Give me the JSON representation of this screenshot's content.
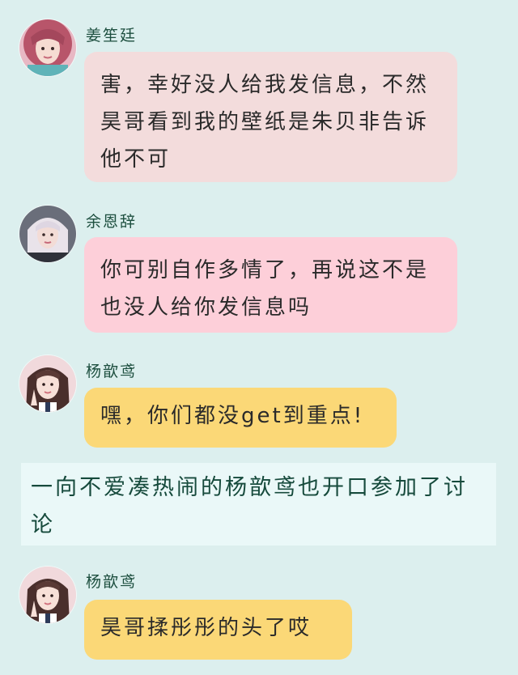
{
  "chat": {
    "messages": [
      {
        "sender": "姜笙廷",
        "text": "害，幸好没人给我发信息，不然昊哥看到我的壁纸是朱贝非告诉他不可",
        "bubble_color": "#f3dcdc"
      },
      {
        "sender": "余恩辞",
        "text": "你可别自作多情了，再说这不是也没人给你发信息吗",
        "bubble_color": "#fdcfd9"
      },
      {
        "sender": "杨歆鸢",
        "text": "嘿，你们都没get到重点!",
        "bubble_color": "#fbd877"
      },
      {
        "sender": "杨歆鸢",
        "text": "昊哥揉彤彤的头了哎",
        "bubble_color": "#fbd877"
      }
    ],
    "narration": "一向不爱凑热闹的杨歆鸢也开口参加了讨论"
  },
  "colors": {
    "background": "#dcefee",
    "name_text": "#1d4f3f",
    "narration_bg": "#eaf8f8"
  }
}
